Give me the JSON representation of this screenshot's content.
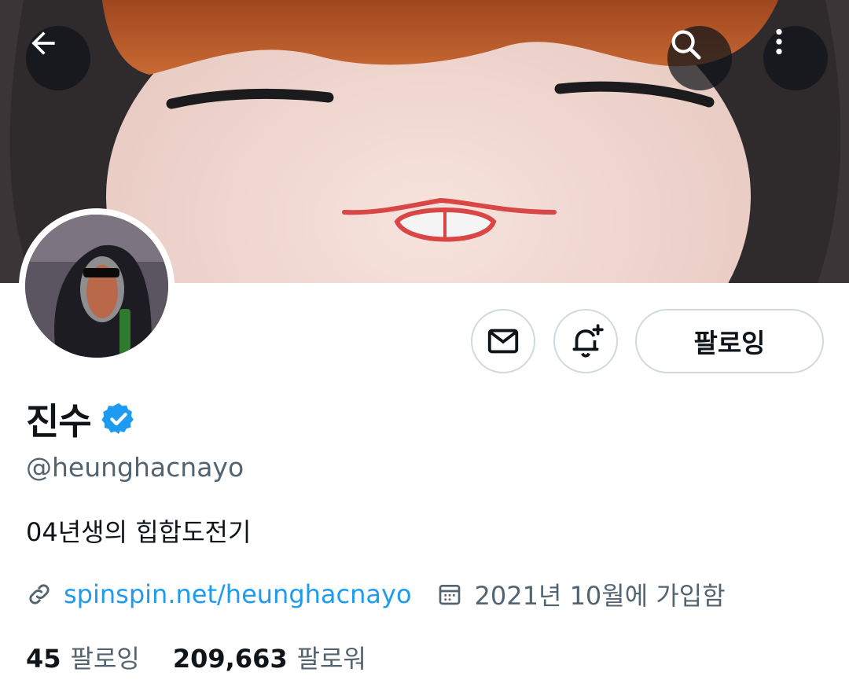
{
  "header": {
    "back_icon": "arrow-left-icon",
    "search_icon": "search-icon",
    "more_icon": "more-vertical-icon"
  },
  "actions": {
    "message_icon": "mail-icon",
    "notify_icon": "bell-plus-icon",
    "follow_label": "팔로잉"
  },
  "profile": {
    "display_name": "진수",
    "verified": true,
    "handle": "@heunghacnayo",
    "bio": "04년생의 힙합도전기",
    "link": "spinspin.net/heunghacnayo",
    "joined": "2021년 10월에 가입함"
  },
  "stats": {
    "following_count": "45",
    "following_label": "팔로잉",
    "followers_count": "209,663",
    "followers_label": "팔로워"
  },
  "colors": {
    "accent": "#1d9bf0",
    "text_primary": "#0f1419",
    "text_secondary": "#536471",
    "border": "#cfd9de"
  }
}
